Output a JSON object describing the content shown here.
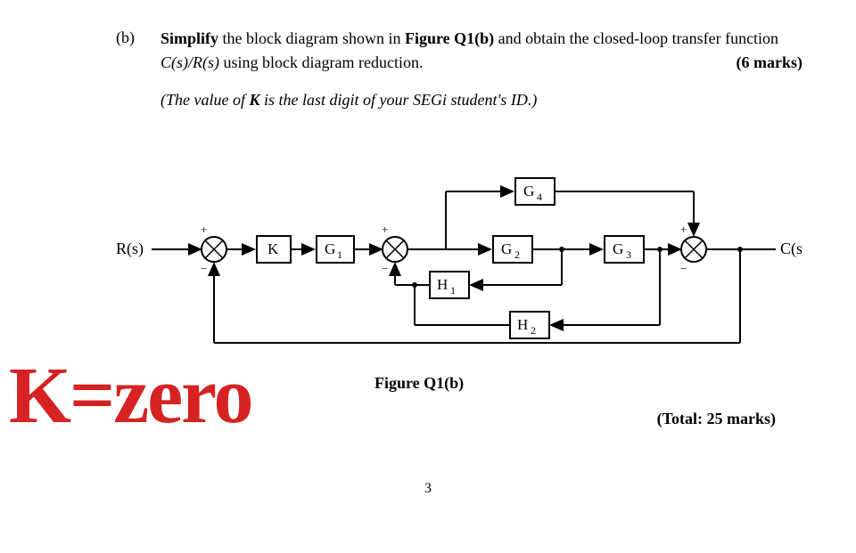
{
  "part_label": "(b)",
  "question_line1a": "Simplify",
  "question_line1b": " the block diagram shown in ",
  "question_line1c": "Figure Q1(b)",
  "question_line1d": " and obtain the closed-loop transfer function ",
  "question_line1e": "C(s)/R(s)",
  "question_line1f": " using block diagram reduction.",
  "marks": "(6 marks)",
  "note_a": "(The value of ",
  "note_b": "K",
  "note_c": " is the last digit of your SEGi student's ID.)",
  "figure_caption": "Figure Q1(b)",
  "total_marks": "(Total: 25 marks)",
  "page_number": "3",
  "handwritten": "K=zero",
  "diagram": {
    "input": "R(s)",
    "output": "C(s)",
    "blocks": {
      "K": "K",
      "G1": "G",
      "G1sub": "1",
      "G2": "G",
      "G2sub": "2",
      "G3": "G",
      "G3sub": "3",
      "G4": "G",
      "G4sub": "4",
      "H1": "H",
      "H1sub": "1",
      "H2": "H",
      "H2sub": "2"
    },
    "sum_signs": {
      "s1_top": "+",
      "s1_bot": "−",
      "s2_top": "+",
      "s2_bot": "−",
      "s3_top": "+",
      "s3_bot": "−"
    }
  }
}
